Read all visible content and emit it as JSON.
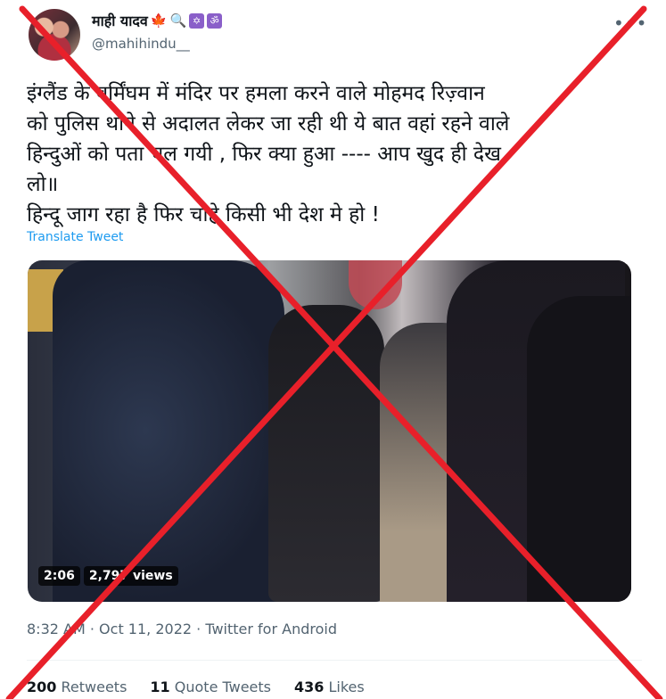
{
  "author": {
    "display_name": "माही यादव",
    "name_emojis": [
      "🍁",
      "🔍",
      "✡",
      "ॐ"
    ],
    "handle": "@mahihindu__"
  },
  "tweet": {
    "text_lines": [
      "इंग्लैंड के बर्मिंघम में मंदिर पर हमला करने वाले मोहमद रिज़्वान",
      "को पुलिस थाने से अदालत लेकर जा रही थी ये बात वहां रहने वाले",
      "हिन्दुओं को पता चल गयी , फिर क्या हुआ  ---- आप खुद ही देख",
      "लो॥",
      "हिन्दू जाग रहा है फिर चाहे किसी भी देश मे हो !"
    ],
    "translate_label": "Translate Tweet"
  },
  "media": {
    "duration": "2:06",
    "views": "2,797 views"
  },
  "meta": {
    "time": "8:32 AM",
    "date": "Oct 11, 2022",
    "source": "Twitter for Android",
    "separator": "·"
  },
  "stats": {
    "retweets_count": "200",
    "retweets_label": "Retweets",
    "quotes_count": "11",
    "quotes_label": "Quote Tweets",
    "likes_count": "436",
    "likes_label": "Likes"
  },
  "icons": {
    "more": "more-horizontal-icon"
  },
  "colors": {
    "cross": "#e8202a",
    "link": "#1d9bf0",
    "secondary_text": "#536471"
  }
}
